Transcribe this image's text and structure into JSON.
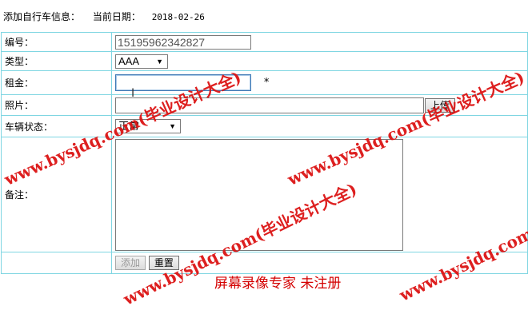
{
  "header": {
    "title": "添加自行车信息：",
    "date_label": "当前日期：",
    "date_value": "2018-02-26"
  },
  "form": {
    "code": {
      "label": "编号：",
      "value": "15195962342827"
    },
    "type": {
      "label": "类型：",
      "selected": "AAA"
    },
    "rent": {
      "label": "租金：",
      "value": "",
      "required_mark": "*"
    },
    "photo": {
      "label": "照片：",
      "value": "",
      "upload_label": "上传"
    },
    "status": {
      "label": "车辆状态：",
      "selected": "正常"
    },
    "notes": {
      "label": "备注：",
      "value": ""
    },
    "buttons": {
      "add_label": "添加",
      "reset_label": "重置"
    }
  },
  "overlay": {
    "watermark": "www.bysjdq.com(毕业设计大全)",
    "recorder": "屏幕录像专家  未注册"
  },
  "colors": {
    "table_border": "#7fd6e2",
    "watermark": "#dc1414",
    "rent_focus": "#3e78b4"
  }
}
